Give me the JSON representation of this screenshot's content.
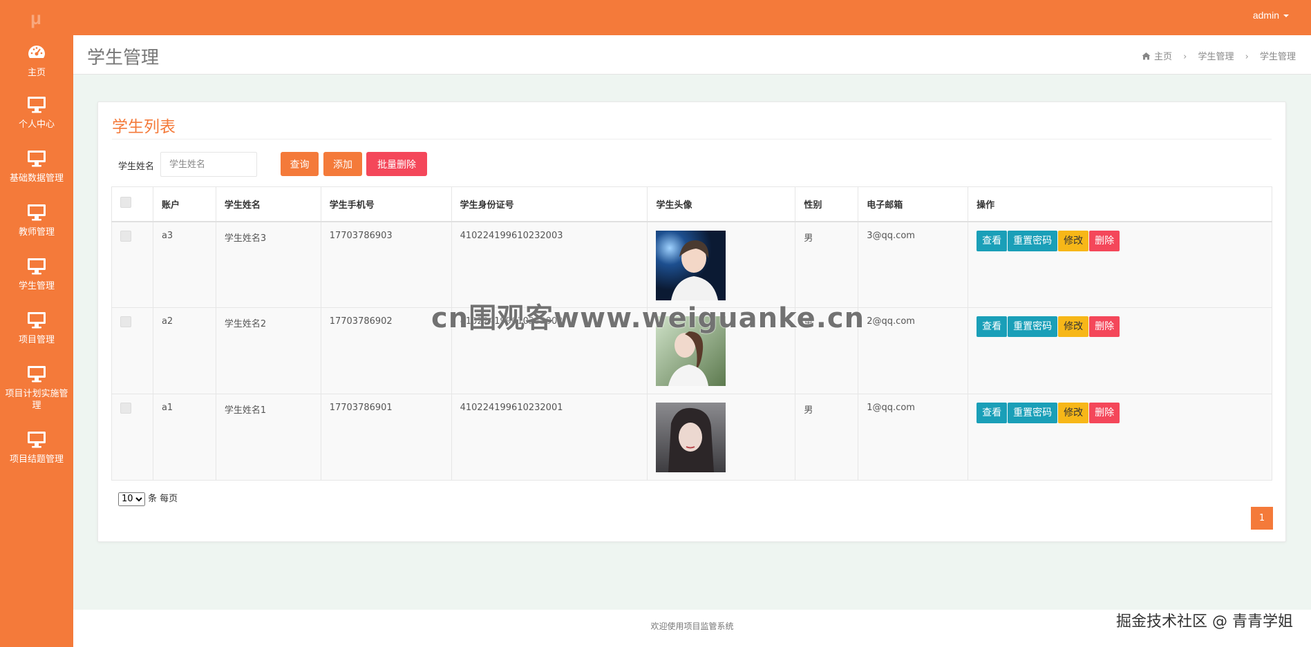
{
  "app": {
    "logo": "μ",
    "user": "admin"
  },
  "sidebar": {
    "items": [
      {
        "label": "主页",
        "icon": "dashboard-icon"
      },
      {
        "label": "个人中心",
        "icon": "monitor-icon"
      },
      {
        "label": "基础数据管理",
        "icon": "monitor-icon"
      },
      {
        "label": "教师管理",
        "icon": "monitor-icon"
      },
      {
        "label": "学生管理",
        "icon": "monitor-icon"
      },
      {
        "label": "项目管理",
        "icon": "monitor-icon"
      },
      {
        "label": "项目计划实施管理",
        "icon": "monitor-icon"
      },
      {
        "label": "项目结题管理",
        "icon": "monitor-icon"
      }
    ]
  },
  "header": {
    "title": "学生管理",
    "breadcrumb": [
      "主页",
      "学生管理",
      "学生管理"
    ]
  },
  "panel": {
    "title": "学生列表",
    "search": {
      "label": "学生姓名",
      "placeholder": "学生姓名",
      "value": ""
    },
    "buttons": {
      "query": "查询",
      "add": "添加",
      "batch_delete": "批量删除"
    }
  },
  "table": {
    "columns": [
      "账户",
      "学生姓名",
      "学生手机号",
      "学生身份证号",
      "学生头像",
      "性别",
      "电子邮箱",
      "操作"
    ],
    "rows": [
      {
        "account": "a3",
        "name": "学生姓名3",
        "phone": "17703786903",
        "id_no": "410224199610232003",
        "gender": "男",
        "email": "3@qq.com"
      },
      {
        "account": "a2",
        "name": "学生姓名2",
        "phone": "17703786902",
        "id_no": "410224199610232002",
        "gender": "男",
        "email": "2@qq.com"
      },
      {
        "account": "a1",
        "name": "学生姓名1",
        "phone": "17703786901",
        "id_no": "410224199610232001",
        "gender": "男",
        "email": "1@qq.com"
      }
    ],
    "actions": {
      "view": "查看",
      "reset": "重置密码",
      "edit": "修改",
      "delete": "删除"
    }
  },
  "pagination": {
    "page_size": "10",
    "page_size_suffix": "条 每页",
    "current_page": "1"
  },
  "footer": {
    "text": "欢迎使用项目监管系统"
  },
  "watermarks": {
    "center": "cn围观客www.weiguanke.cn",
    "bottom_right": "掘金技术社区 @ 青青学姐"
  },
  "colors": {
    "brand": "#f47a3a",
    "info": "#1a9fb8",
    "warning": "#f7b718",
    "danger": "#f4475a",
    "content_bg": "#eef5f1"
  }
}
